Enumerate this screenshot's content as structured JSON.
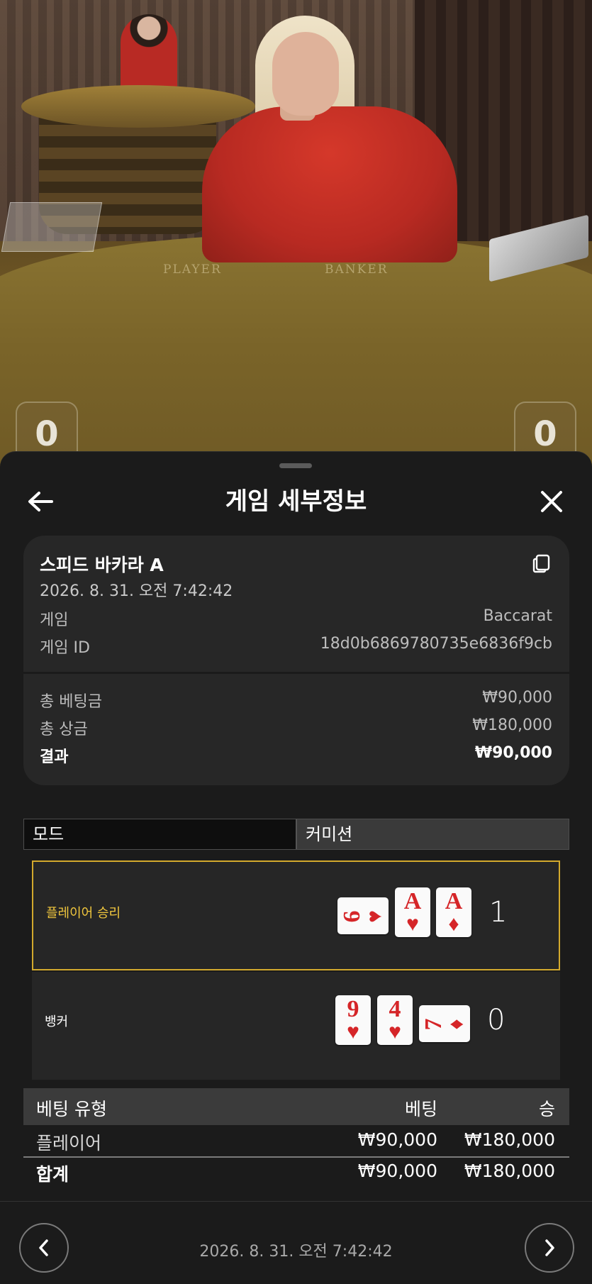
{
  "video": {
    "table_labels": {
      "player": "PLAYER",
      "banker": "BANKER"
    },
    "player_score": "0",
    "banker_score": "0"
  },
  "header": {
    "title": "게임 세부정보",
    "back_icon": "arrow-left-icon",
    "close_icon": "close-icon"
  },
  "details": {
    "game_name": "스피드 바카라 A",
    "datetime": "2026. 8. 31. 오전 7:42:42",
    "copy_icon": "copy-icon",
    "rows": [
      {
        "label": "게임",
        "value": "Baccarat"
      },
      {
        "label": "게임 ID",
        "value": "18d0b6869780735e6836f9cb"
      }
    ],
    "totals": [
      {
        "label": "총 베팅금",
        "value": "₩90,000"
      },
      {
        "label": "총 상금",
        "value": "₩180,000"
      },
      {
        "label": "결과",
        "value": "₩90,000"
      }
    ]
  },
  "tabs": [
    {
      "label": "모드",
      "active": true
    },
    {
      "label": "커미션",
      "active": false
    }
  ],
  "results": [
    {
      "label": "플레이어 승리",
      "winner": true,
      "score": "1",
      "cards": [
        {
          "rank": "6",
          "suit": "♥",
          "orientation": "sideways"
        },
        {
          "rank": "A",
          "suit": "♥",
          "orientation": "upright"
        },
        {
          "rank": "A",
          "suit": "♦",
          "orientation": "upright"
        }
      ]
    },
    {
      "label": "뱅커",
      "winner": false,
      "score": "0",
      "cards": [
        {
          "rank": "9",
          "suit": "♥",
          "orientation": "upright"
        },
        {
          "rank": "4",
          "suit": "♥",
          "orientation": "upright"
        },
        {
          "rank": "7",
          "suit": "♦",
          "orientation": "sideways"
        }
      ]
    }
  ],
  "bets": {
    "headers": {
      "type": "베팅 유형",
      "bet": "베팅",
      "win": "승"
    },
    "rows": [
      {
        "type": "플레이어",
        "bet": "₩90,000",
        "win": "₩180,000"
      }
    ],
    "total": {
      "type": "합계",
      "bet": "₩90,000",
      "win": "₩180,000"
    }
  },
  "footer": {
    "datetime": "2026. 8. 31. 오전 7:42:42",
    "prev_icon": "chevron-left-icon",
    "next_icon": "chevron-right-icon"
  },
  "colors": {
    "accent_gold": "#d3a92d",
    "winner_label": "#f0c63d",
    "card_red": "#d52528",
    "sheet_bg": "#1b1b1b",
    "card_bg": "#272727"
  }
}
